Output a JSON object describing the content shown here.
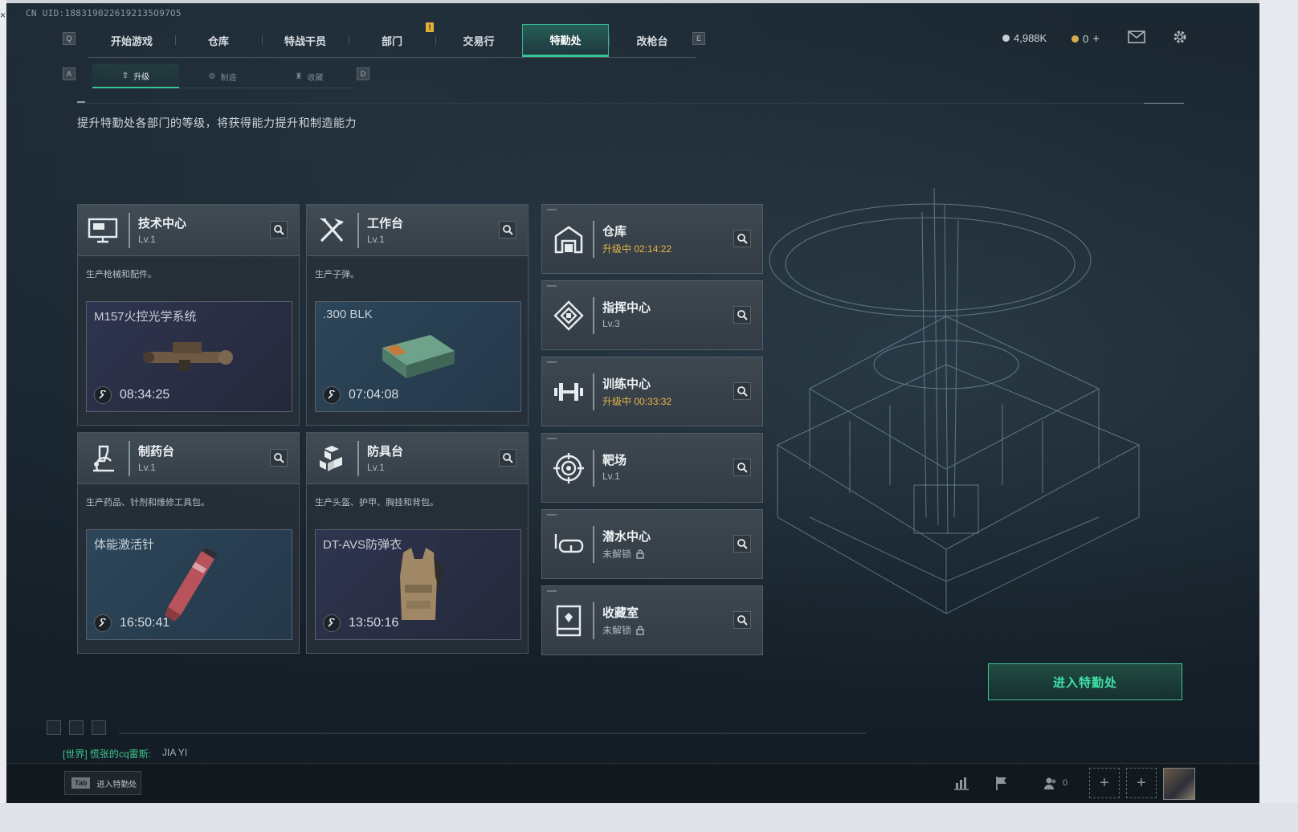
{
  "uid": "CN UID:1883190226192135O97O5",
  "nav": {
    "key_left": "Q",
    "key_right": "E",
    "tabs": [
      "开始游戏",
      "仓库",
      "特战干员",
      "部门",
      "交易行",
      "特勤处",
      "改枪台"
    ],
    "active": "特勤处",
    "badge": "!"
  },
  "currency": {
    "silver": "4,988K",
    "gold": "0",
    "plus": "+"
  },
  "subnav": {
    "key_left": "A",
    "key_right": "D",
    "tabs": [
      "升级",
      "制造",
      "收藏"
    ],
    "active": "升级"
  },
  "description": "提升特勤处各部门的等级，将获得能力提升和制造能力",
  "workshops": [
    {
      "name": "技术中心",
      "level": "Lv.1",
      "desc": "生产枪械和配件。",
      "product": "M157火控光学系统",
      "timer": "08:34:25",
      "icon": "monitor-icon",
      "style": "dark"
    },
    {
      "name": "工作台",
      "level": "Lv.1",
      "desc": "生产子弹。",
      "product": ".300 BLK",
      "timer": "07:04:08",
      "icon": "tools-icon",
      "style": "teal"
    },
    {
      "name": "制药台",
      "level": "Lv.1",
      "desc": "生产药品、针剂和维修工具包。",
      "product": "体能激活针",
      "timer": "16:50:41",
      "icon": "microscope-icon",
      "style": "teal"
    },
    {
      "name": "防具台",
      "level": "Lv.1",
      "desc": "生产头盔、护甲、胸挂和背包。",
      "product": "DT-AVS防弹衣",
      "timer": "13:50:16",
      "icon": "boxes-icon",
      "style": "dark"
    }
  ],
  "facilities": [
    {
      "name": "仓库",
      "status": "升级中 02:14:22",
      "state": "upgrading",
      "icon": "warehouse-icon"
    },
    {
      "name": "指挥中心",
      "status": "Lv.3",
      "state": "level",
      "icon": "command-icon"
    },
    {
      "name": "训练中心",
      "status": "升级中 00:33:32",
      "state": "upgrading",
      "icon": "dumbbell-icon"
    },
    {
      "name": "靶场",
      "status": "Lv.1",
      "state": "level",
      "icon": "target-icon"
    },
    {
      "name": "潜水中心",
      "status": "未解锁",
      "state": "locked",
      "icon": "diving-mask-icon"
    },
    {
      "name": "收藏室",
      "status": "未解锁",
      "state": "locked",
      "icon": "collection-icon"
    }
  ],
  "enter_button": "进入特勤处",
  "chat": {
    "channel": "[世界] 慌张的cq雷斯:",
    "message": "JIA YI"
  },
  "tab_hint": {
    "key": "Tab",
    "label": "进入特勤处"
  },
  "squad_count": "0",
  "colors": {
    "accent": "#35c596",
    "upgrading": "#e7b64a",
    "panel": "#3e4850"
  }
}
